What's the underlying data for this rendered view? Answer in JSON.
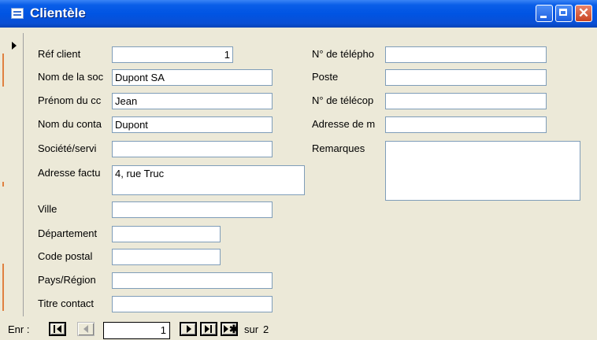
{
  "window": {
    "title": "Clientèle",
    "icon": "form-icon",
    "controls": [
      "minimize-icon",
      "maximize-icon",
      "close-icon"
    ],
    "colors": {
      "titlebar": "#0054e3",
      "close": "#c94422",
      "face": "#ece9d8",
      "field_border": "#7f9db9"
    }
  },
  "left_fields": [
    {
      "label": "Réf client",
      "value": "1"
    },
    {
      "label": "Nom de la soc",
      "value": "Dupont SA"
    },
    {
      "label": "Prénom du cc",
      "value": "Jean"
    },
    {
      "label": "Nom du conta",
      "value": "Dupont"
    },
    {
      "label": "Société/servi",
      "value": ""
    },
    {
      "label": "Adresse factu",
      "value": "4, rue Truc"
    },
    {
      "label": "Ville",
      "value": ""
    },
    {
      "label": "Département",
      "value": ""
    },
    {
      "label": "Code postal",
      "value": ""
    },
    {
      "label": "Pays/Région",
      "value": ""
    },
    {
      "label": "Titre contact",
      "value": ""
    }
  ],
  "right_fields": [
    {
      "label": "N° de télépho",
      "value": ""
    },
    {
      "label": "Poste",
      "value": ""
    },
    {
      "label": "N° de télécop",
      "value": ""
    },
    {
      "label": "Adresse de m",
      "value": ""
    },
    {
      "label": "Remarques",
      "value": ""
    }
  ],
  "navigation": {
    "label": "Enr :",
    "current": "1",
    "of_label": "sur",
    "total": "2",
    "buttons": [
      "first-record-icon",
      "previous-record-icon",
      "next-record-icon",
      "last-record-icon",
      "new-record-icon"
    ]
  }
}
